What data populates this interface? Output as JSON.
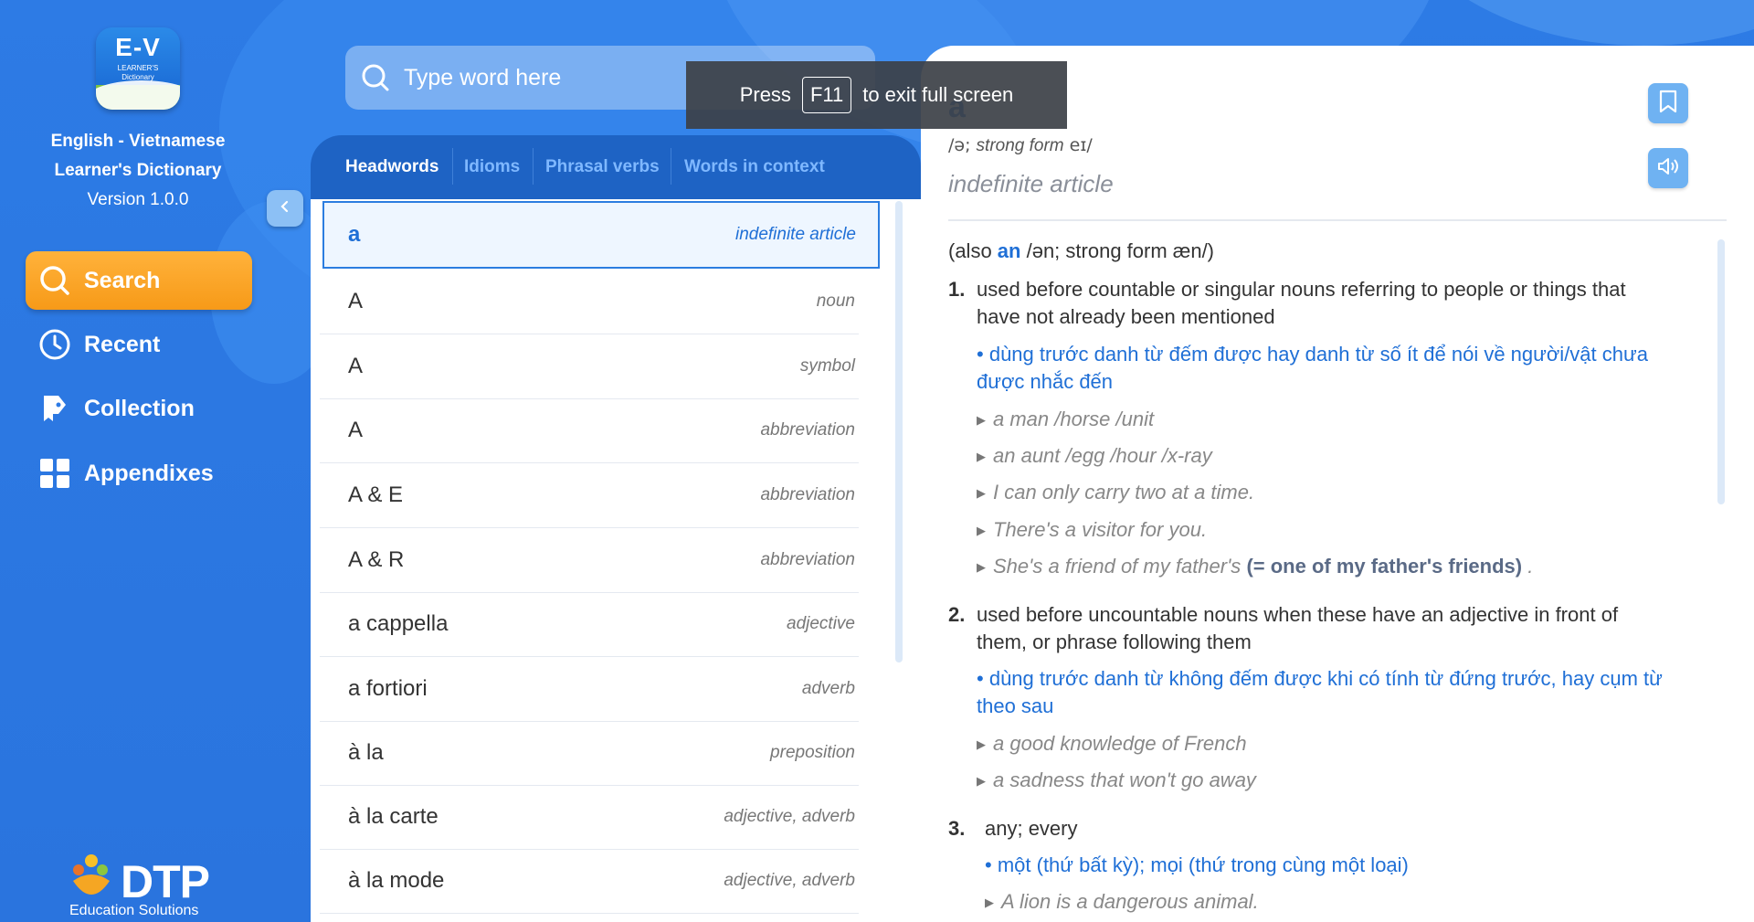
{
  "app": {
    "logo_main": "E-V",
    "logo_sub_1": "LEARNER'S",
    "logo_sub_2": "Dictionary",
    "title_line1": "English - Vietnamese",
    "title_line2": "Learner's Dictionary",
    "version": "Version 1.0.0",
    "footer_brand": "DTP",
    "footer_tagline": "Education Solutions",
    "colors": {
      "primary": "#2d7be5",
      "accent": "#f79a18",
      "link": "#1f6fd6"
    }
  },
  "nav": [
    {
      "label": "Search",
      "icon": "search-icon",
      "active": true
    },
    {
      "label": "Recent",
      "icon": "clock-icon",
      "active": false
    },
    {
      "label": "Collection",
      "icon": "collection-icon",
      "active": false
    },
    {
      "label": "Appendixes",
      "icon": "grid-icon",
      "active": false
    }
  ],
  "search": {
    "placeholder": "Type word here",
    "value": ""
  },
  "toast": {
    "prefix": "Press",
    "key": "F11",
    "suffix": "to exit full screen"
  },
  "tabs": [
    "Headwords",
    "Idioms",
    "Phrasal verbs",
    "Words in context"
  ],
  "word_list": [
    {
      "word": "a",
      "pos": "indefinite article"
    },
    {
      "word": "A",
      "pos": "noun"
    },
    {
      "word": "A",
      "pos": "symbol"
    },
    {
      "word": "A",
      "pos": "abbreviation"
    },
    {
      "word": "A & E",
      "pos": "abbreviation"
    },
    {
      "word": "A & R",
      "pos": "abbreviation"
    },
    {
      "word": "a cappella",
      "pos": "adjective"
    },
    {
      "word": "a fortiori",
      "pos": "adverb"
    },
    {
      "word": "à la",
      "pos": "preposition"
    },
    {
      "word": "à la carte",
      "pos": "adjective, adverb"
    },
    {
      "word": "à la mode",
      "pos": "adjective, adverb"
    }
  ],
  "entry": {
    "headword": "a",
    "pron_prefix": "/ə; ",
    "pron_strong_label": "strong form",
    "pron_strong": " eɪ/",
    "pos": "indefinite article",
    "also_prefix": "(also ",
    "also_word": "an",
    "also_suffix": " /ən; strong form æn/)",
    "senses": [
      {
        "num": "1.",
        "text_1": "used before countable or singular nouns referring to people or things that",
        "text_2": "have not already been mentioned",
        "trans_1": "dùng trước danh từ đếm được hay danh từ số ít để nói về người/vật chưa",
        "trans_2": "được nhắc đến",
        "examples": [
          "a man /horse /unit",
          "an aunt /egg /hour /x-ray",
          "I can only carry two at a time.",
          "There's a visitor for you.",
          "She's a friend of my father's"
        ],
        "example_note": "(= one of my father's friends)",
        "example_end": " ."
      },
      {
        "num": "2.",
        "text_1": "used before uncountable nouns when these have an adjective in front of",
        "text_2": "them, or phrase following them",
        "trans_1": "dùng trước danh từ không đếm được khi có tính từ đứng trước, hay cụm từ",
        "trans_2": "theo sau",
        "examples": [
          "a good knowledge of French",
          "a sadness that won't go away"
        ]
      },
      {
        "num": "3.",
        "text_1": "any; every",
        "trans_1": "một (thứ bất kỳ); mọi (thứ trong cùng một loại)",
        "examples": [
          "A lion is a dangerous animal."
        ]
      }
    ]
  }
}
